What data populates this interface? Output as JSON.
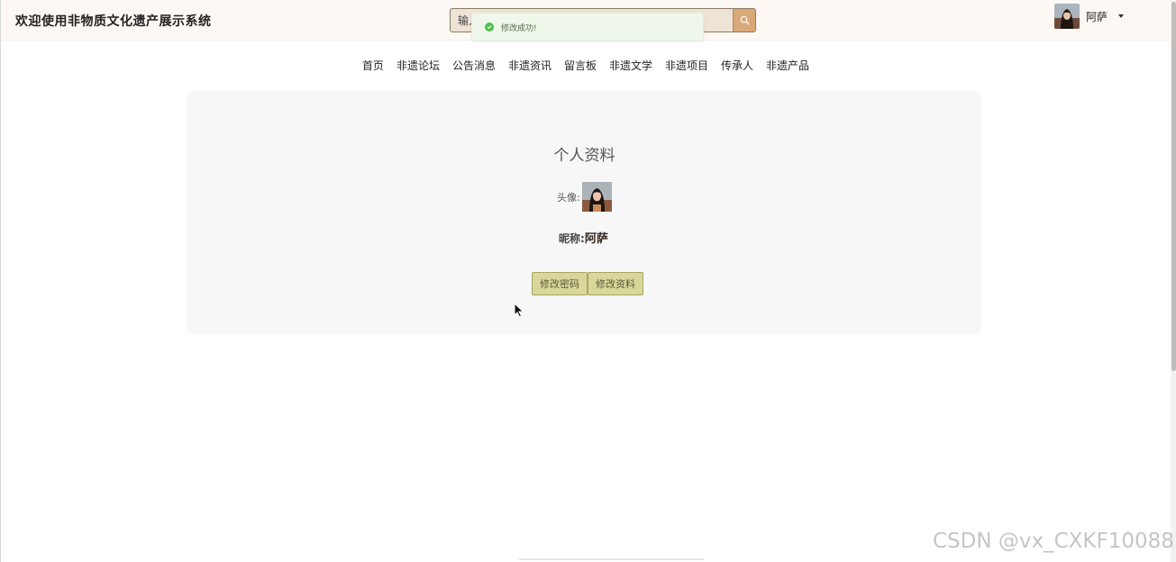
{
  "header": {
    "site_title": "欢迎使用非物质文化遗产展示系统",
    "search_placeholder": "输入",
    "user_name": "阿萨"
  },
  "toast": {
    "message": "修改成功!"
  },
  "nav": {
    "items": [
      {
        "label": "首页"
      },
      {
        "label": "非遗论坛"
      },
      {
        "label": "公告消息"
      },
      {
        "label": "非遗资讯"
      },
      {
        "label": "留言板"
      },
      {
        "label": "非遗文学"
      },
      {
        "label": "非遗项目"
      },
      {
        "label": "传承人"
      },
      {
        "label": "非遗产品"
      }
    ]
  },
  "profile": {
    "title": "个人资料",
    "avatar_label": "头像:",
    "nickname_label": "昵称:",
    "nickname_value": "阿萨",
    "change_password_label": "修改密码",
    "edit_profile_label": "修改资料"
  },
  "watermark": "CSDN @vx_CXKF10088",
  "colors": {
    "header_bg": "#fdf8f4",
    "search_btn": "#d9a878",
    "button_bg": "#d8d79a",
    "toast_bg": "#eef7ea",
    "toast_icon": "#4fbf4a",
    "card_bg": "#f7f7f7"
  },
  "icons": [
    "search-icon",
    "check-circle-icon",
    "caret-down-icon",
    "mouse-cursor"
  ]
}
